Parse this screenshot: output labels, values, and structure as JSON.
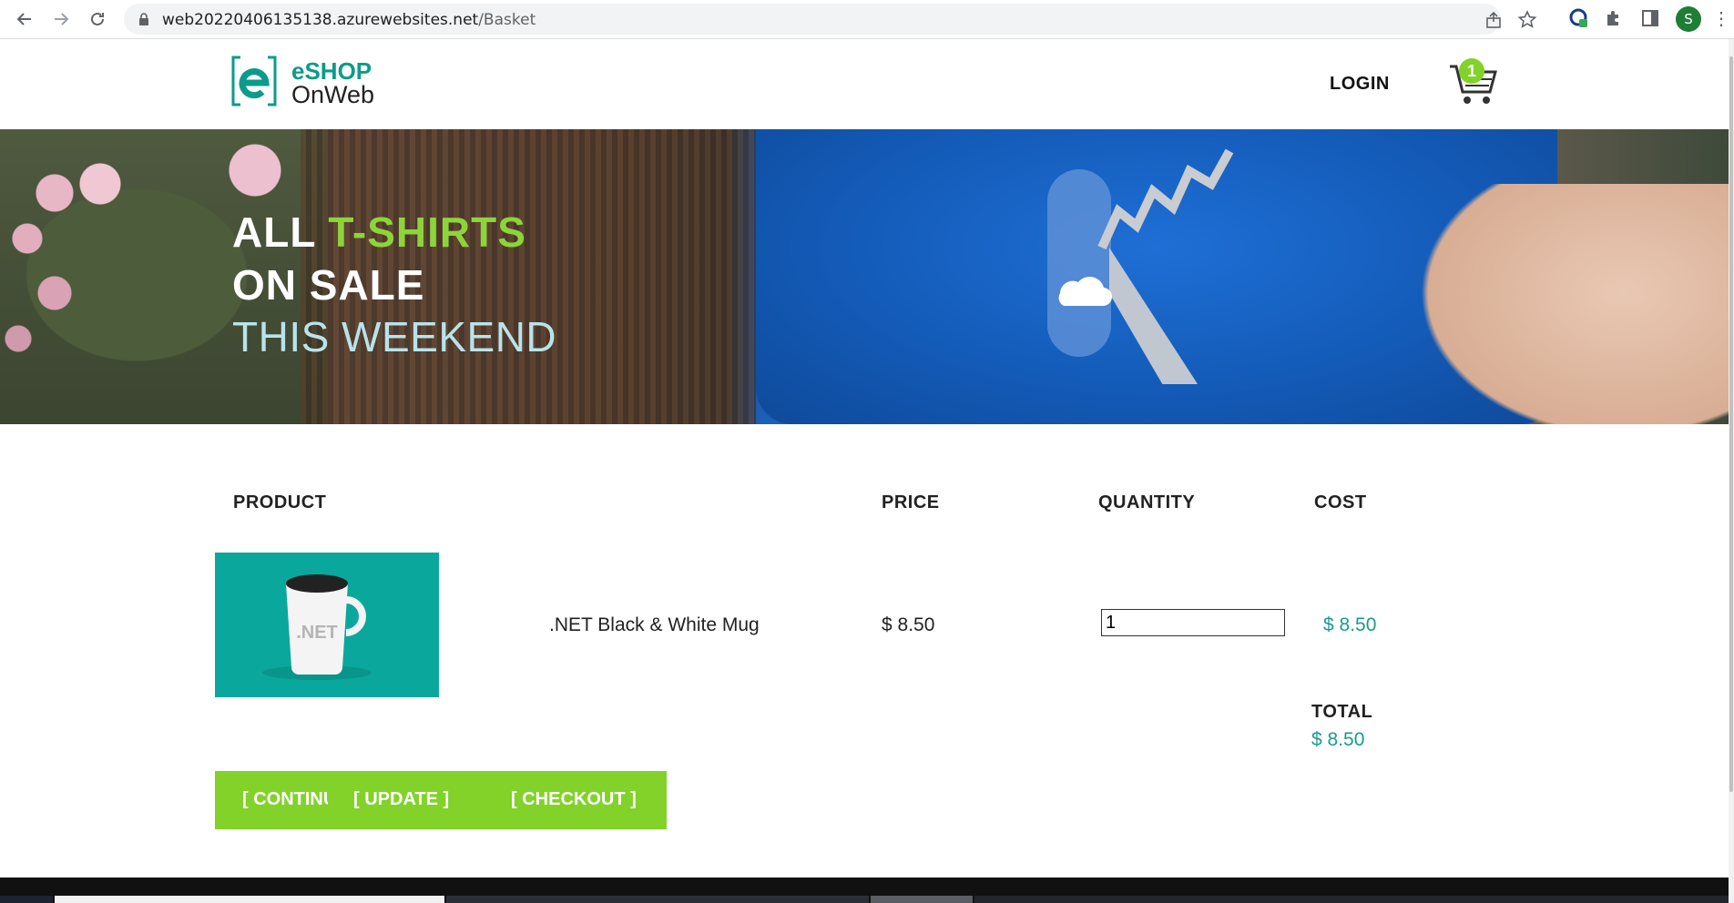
{
  "browser": {
    "url_host": "web20220406135138.azurewebsites.net",
    "url_path": "/Basket",
    "profile_initial": "S"
  },
  "header": {
    "logo_line1": "eSHOP",
    "logo_line2": "OnWeb",
    "login_label": "LOGIN",
    "cart_count": "1"
  },
  "banner": {
    "line1_prefix": "ALL ",
    "line1_accent": "T-SHIRTS",
    "line2": "ON SALE",
    "line3": "THIS WEEKEND"
  },
  "basket": {
    "columns": {
      "product": "PRODUCT",
      "price": "PRICE",
      "quantity": "QUANTITY",
      "cost": "COST"
    },
    "items": [
      {
        "image_label": ".NET",
        "name": ".NET Black & White Mug",
        "price": "$ 8.50",
        "quantity": "1",
        "cost": "$ 8.50"
      }
    ],
    "total_label": "TOTAL",
    "total_value": "$ 8.50",
    "actions": {
      "continue_label": "[ CONTINUE SHOPPING ]",
      "update_label": "[ UPDATE ]",
      "checkout_label": "[ CHECKOUT ]"
    }
  },
  "colors": {
    "accent_green": "#82d22a",
    "teal": "#1b9a8f",
    "brand_teal": "#0b9b8b"
  }
}
